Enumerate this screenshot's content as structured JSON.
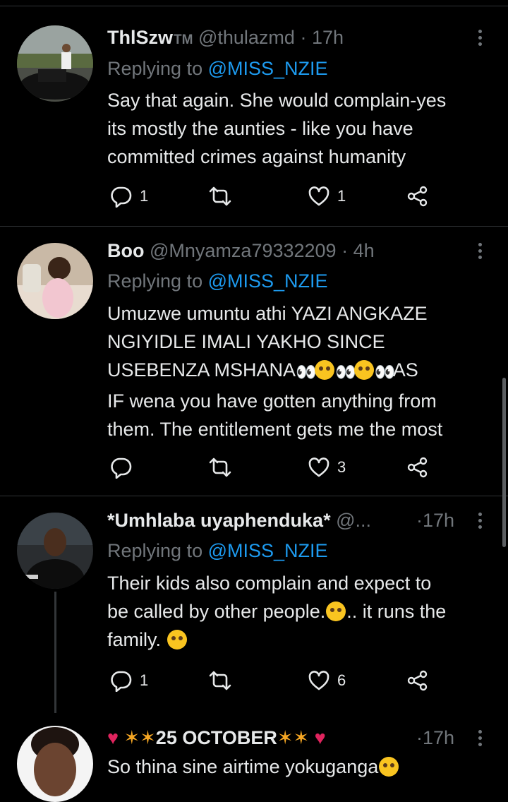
{
  "tweets": [
    {
      "name": "ThlSzw",
      "name_suffix": "TM",
      "handle": "@thulazmd",
      "dot": "·",
      "time": "17h",
      "replying_prefix": "Replying to ",
      "replying_to": "@MISS_NZIE",
      "body": "Say that again. She would complain-yes\nits mostly the aunties - like you have\ncommitted crimes against humanity",
      "reply_count": "1",
      "retweet_count": "",
      "like_count": "1"
    },
    {
      "name": "Boo",
      "handle": "@Mnyamza79332209",
      "dot": "·",
      "time": "4h",
      "replying_prefix": "Replying to ",
      "replying_to": "@MISS_NZIE",
      "body_line1": "Umuzwe umuntu athi YAZI ANGKAZE",
      "body_line2": "NGIYIDLE IMALI YAKHO SINCE",
      "body_line3a": "USEBENZA MSHANA",
      "body_line3b": "AS",
      "body_line4": "IF wena you have gotten anything from",
      "body_line5": "them. The entitlement gets me the most",
      "reply_count": "",
      "retweet_count": "",
      "like_count": "3"
    },
    {
      "name": "*Umhlaba uyaphenduka*",
      "handle": "@...",
      "dot": "·",
      "time": "17h",
      "replying_prefix": "Replying to ",
      "replying_to": "@MISS_NZIE",
      "body_line1": "Their kids also complain and expect to",
      "body_line2a": "be called by other people.",
      "body_line2b": ".. it runs the",
      "body_line3": "family.",
      "reply_count": "1",
      "retweet_count": "",
      "like_count": "6"
    },
    {
      "name_text": "25 OCTOBER",
      "dot": "·",
      "time": "17h",
      "body": "So thina sine airtime yokuganga"
    }
  ],
  "icons": [
    "reply-icon",
    "retweet-icon",
    "like-icon",
    "share-icon",
    "more-icon"
  ],
  "colors": {
    "background": "#000000",
    "link": "#1d9bf0",
    "muted": "#71767b",
    "text": "#e7e9ea"
  }
}
